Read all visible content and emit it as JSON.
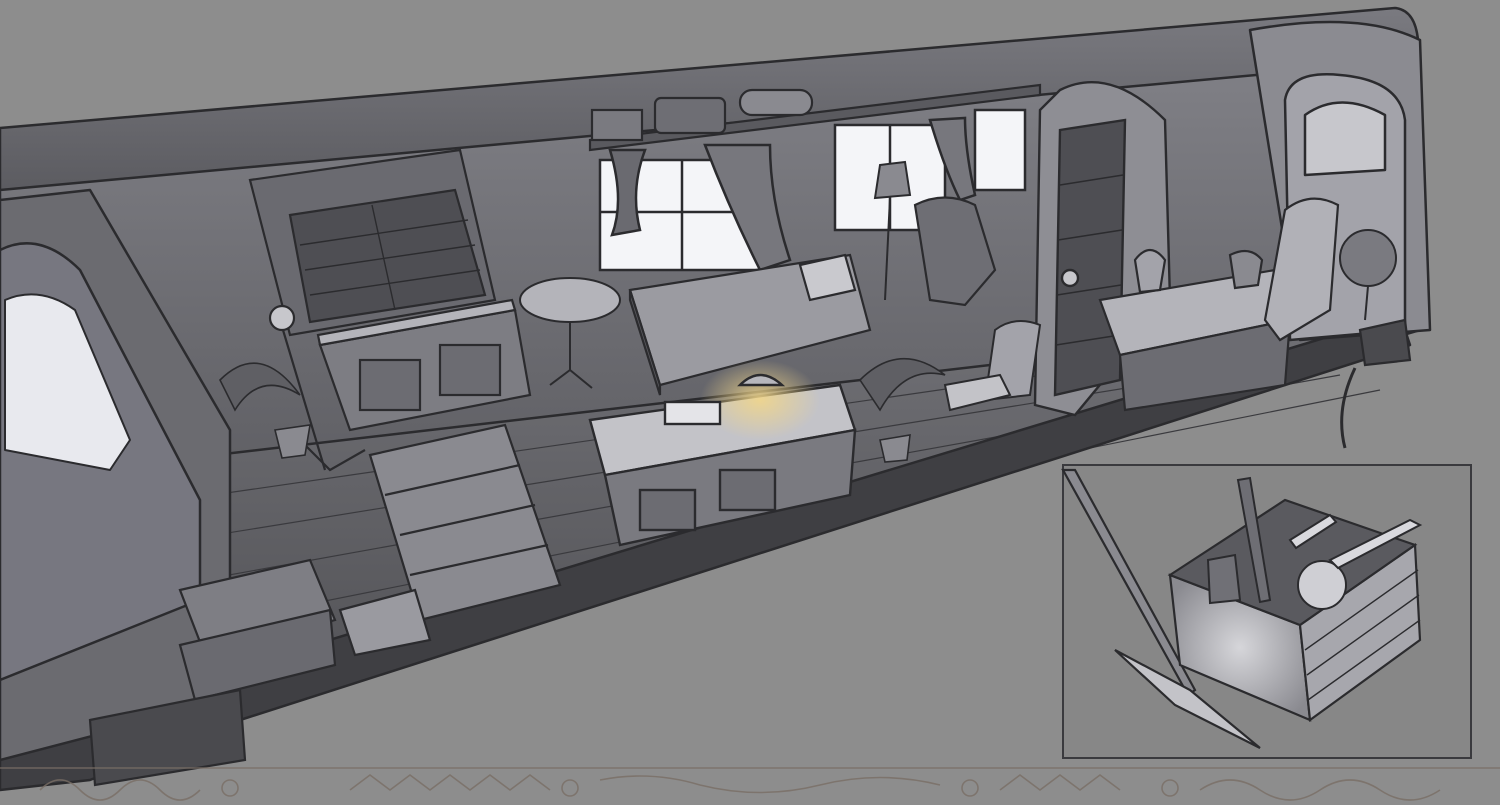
{
  "scene": {
    "subject": "train-carriage-interior-concept-art",
    "palette": {
      "background": "#8d8d8d",
      "ink": "#2b2b2e",
      "wall": "#6f6f74",
      "wall_light": "#9b9ba1",
      "floor": "#5c5c60",
      "furniture": "#7d7d83",
      "furniture_light": "#b4b4ba",
      "window_glow": "#f4f5f8",
      "lamp_glow": "#f1d68a",
      "inset_bg": "#878787",
      "ornament": "#7a6f66"
    },
    "inset": {
      "present": true,
      "depicts": "crate-with-skull-and-bones-and-spear"
    },
    "ornament_border": {
      "present": true
    }
  }
}
